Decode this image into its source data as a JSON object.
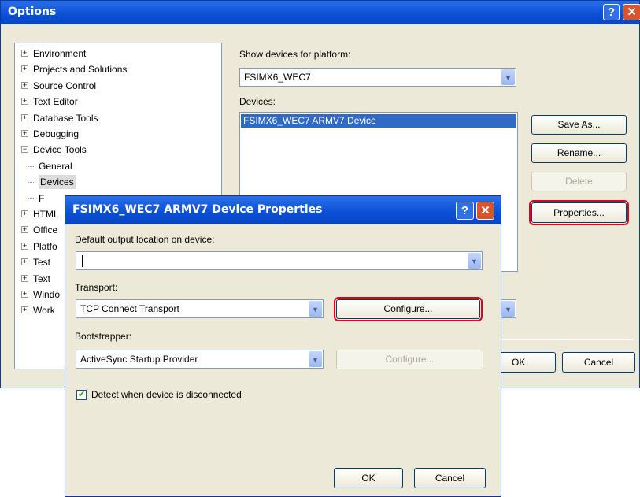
{
  "options_dialog": {
    "title": "Options",
    "tree": [
      {
        "label": "Environment",
        "expander": "+"
      },
      {
        "label": "Projects and Solutions",
        "expander": "+"
      },
      {
        "label": "Source Control",
        "expander": "+"
      },
      {
        "label": "Text Editor",
        "expander": "+"
      },
      {
        "label": "Database Tools",
        "expander": "+"
      },
      {
        "label": "Debugging",
        "expander": "+"
      },
      {
        "label": "Device Tools",
        "expander": "−"
      },
      {
        "label": "General",
        "child": true
      },
      {
        "label": "Devices",
        "child": true,
        "selected": true
      },
      {
        "label": "F",
        "child": true
      },
      {
        "label": "HTML",
        "expander": "+"
      },
      {
        "label": "Office",
        "expander": "+"
      },
      {
        "label": "Platfo",
        "expander": "+"
      },
      {
        "label": "Test",
        "expander": "+"
      },
      {
        "label": "Text",
        "expander": "+"
      },
      {
        "label": "Windo",
        "expander": "+"
      },
      {
        "label": "Work",
        "expander": "+"
      }
    ],
    "platform_label": "Show devices for platform:",
    "platform_value": "FSIMX6_WEC7",
    "devices_label": "Devices:",
    "devices": [
      "FSIMX6_WEC7 ARMV7 Device"
    ],
    "save_as": "Save As...",
    "rename": "Rename...",
    "delete": "Delete",
    "properties": "Properties...",
    "ok": "OK",
    "cancel": "Cancel"
  },
  "props_dialog": {
    "title": "FSIMX6_WEC7 ARMV7 Device Properties",
    "output_label": "Default output location on device:",
    "output_value": "",
    "transport_label": "Transport:",
    "transport_value": "TCP Connect Transport",
    "configure_transport": "Configure...",
    "bootstrapper_label": "Bootstrapper:",
    "bootstrapper_value": "ActiveSync Startup Provider",
    "configure_bootstrapper": "Configure...",
    "detect_label": "Detect when device is disconnected",
    "detect_checked": true,
    "ok": "OK",
    "cancel": "Cancel"
  },
  "colors": {
    "title_bar": "#0a4fd6",
    "highlight": "#e3001b",
    "selection": "#316ac5",
    "dialog_bg": "#ece9d8"
  },
  "icons": {
    "help": "?",
    "close": "✕",
    "dropdown": "▼",
    "check": "✔"
  }
}
